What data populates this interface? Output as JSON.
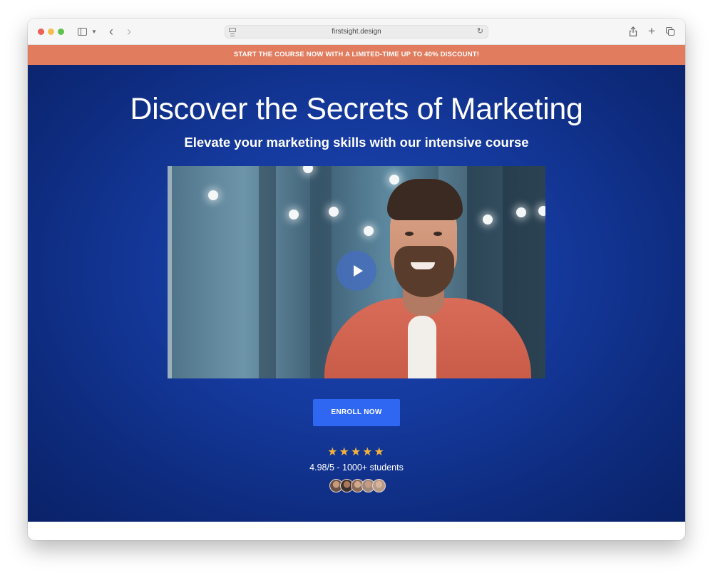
{
  "browser": {
    "url": "firstsight.design"
  },
  "banner": {
    "text": "START THE COURSE NOW WITH A LIMITED-TIME UP TO 40% DISCOUNT!"
  },
  "hero": {
    "headline": "Discover the Secrets of Marketing",
    "subheadline": "Elevate your marketing skills with our intensive course",
    "enroll_label": "ENROLL NOW",
    "stars": "★★★★★",
    "rating_text": "4.98/5 - 1000+ students",
    "student_avatar_count": 5
  },
  "icons": {
    "back": "chevron-left-icon",
    "forward": "chevron-right-icon",
    "reload": "reload-icon",
    "share": "share-icon",
    "new_tab": "plus-icon",
    "tabs": "tabs-overview-icon",
    "sidebar": "sidebar-icon",
    "play": "play-icon",
    "star": "star-icon"
  },
  "colors": {
    "banner": "#e17c5e",
    "hero_background": "#153a9e",
    "enroll_button": "#2f67f2",
    "stars": "#f2b33c"
  }
}
